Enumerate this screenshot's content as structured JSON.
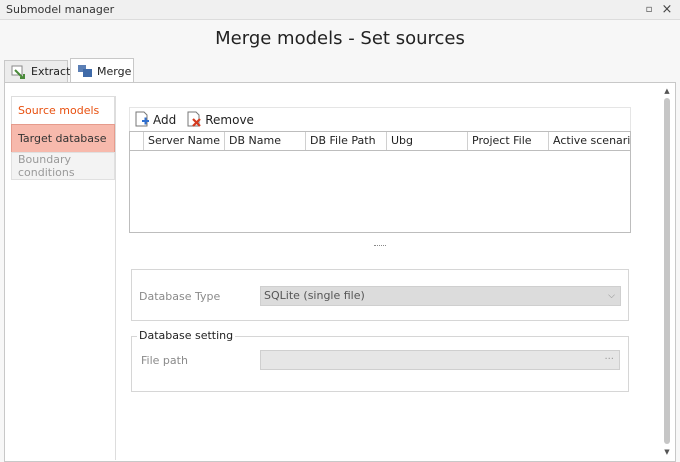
{
  "window": {
    "title": "Submodel manager",
    "restore_icon": "▫",
    "close_icon": "×"
  },
  "page_title": "Merge models - Set sources",
  "tabs": [
    {
      "label": "Extract",
      "icon": "extract-icon"
    },
    {
      "label": "Merge",
      "icon": "merge-icon",
      "active": true
    }
  ],
  "sidebar": {
    "items": [
      {
        "label": "Source models",
        "state": "active"
      },
      {
        "label": "Target database",
        "state": "selected"
      },
      {
        "label": "Boundary conditions",
        "state": "disabled"
      }
    ]
  },
  "toolbar": {
    "add_label": "Add",
    "remove_label": "Remove"
  },
  "grid": {
    "columns": [
      "",
      "Server Name",
      "DB Name",
      "DB File Path",
      "Ubg",
      "Project File",
      "Active scenario"
    ],
    "rows": []
  },
  "database": {
    "type_label": "Database Type",
    "type_value": "SQLite (single file)",
    "setting_title": "Database setting",
    "file_path_label": "File path",
    "file_path_value": "",
    "browse_label": "···"
  },
  "colors": {
    "accent": "#e8500f",
    "selected_bg": "#f7b9ac"
  }
}
